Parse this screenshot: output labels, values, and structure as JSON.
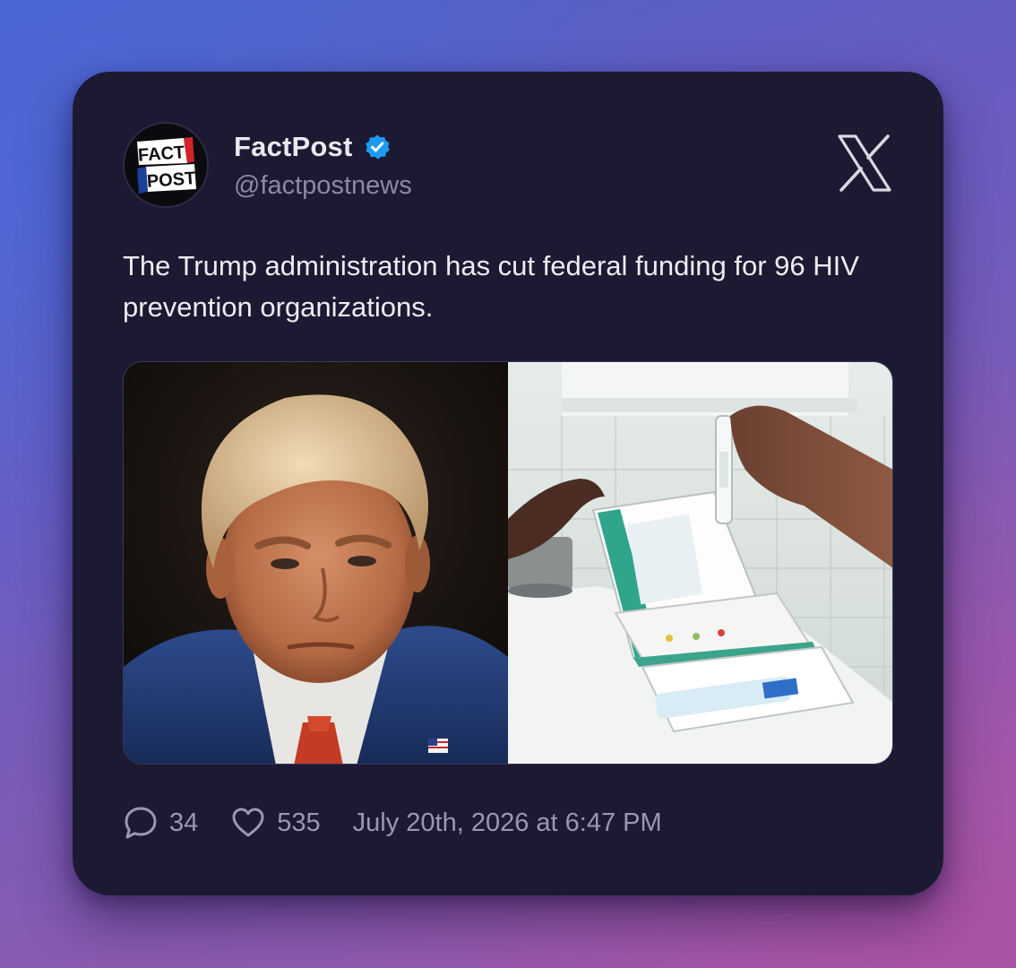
{
  "post": {
    "display_name": "FactPost",
    "handle": "@factpostnews",
    "avatar_text_top": "FACT",
    "avatar_text_bottom": "POST",
    "verified": true,
    "text": "The Trump administration has cut federal funding for 96 HIV prevention organizations.",
    "media": [
      {
        "description_icon": "portrait-photo"
      },
      {
        "description_icon": "test-kit-photo"
      }
    ],
    "replies": "34",
    "likes": "535",
    "timestamp": "July 20th, 2026 at 6:47 PM"
  },
  "icons": {
    "platform": "x-logo-icon",
    "verified": "verified-badge-icon",
    "reply": "speech-bubble-icon",
    "like": "heart-icon"
  },
  "colors": {
    "card_bg": "#1c1a32",
    "verified_blue": "#1d9bf0",
    "avatar_red": "#d0242a",
    "avatar_blue": "#1c3f9a"
  }
}
